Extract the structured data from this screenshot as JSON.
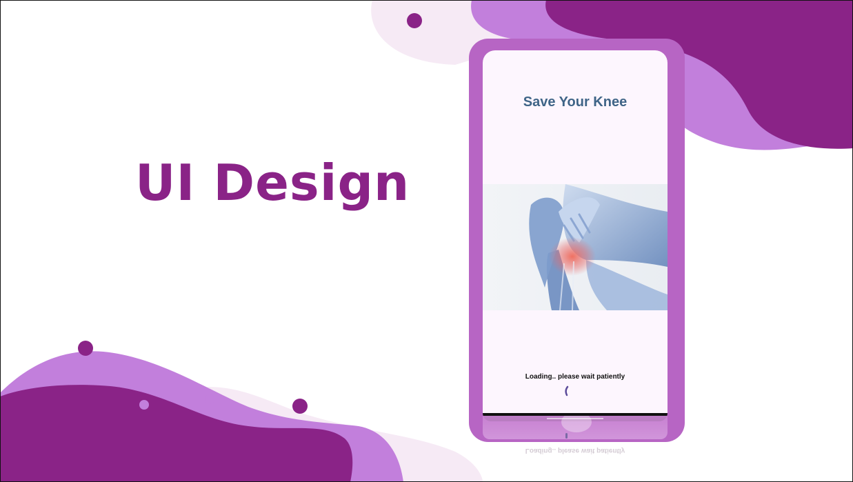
{
  "slide": {
    "headline": "UI Design"
  },
  "app": {
    "title": "Save Your Knee",
    "hero_image": "knee-pain-xray-photo",
    "loading_text": "Loading.. please wait patiently"
  },
  "colors": {
    "headline": "#8a2387",
    "blob_dark": "#8a2387",
    "blob_light": "#c27fdc",
    "blob_pale": "#f6eaf5",
    "phone_frame": "#b765c4",
    "screen_bg": "#fdf6fe",
    "app_title": "#3f6487",
    "spinner": "#5b4b9a"
  },
  "icons": {
    "spinner": "loading-spinner-icon"
  }
}
